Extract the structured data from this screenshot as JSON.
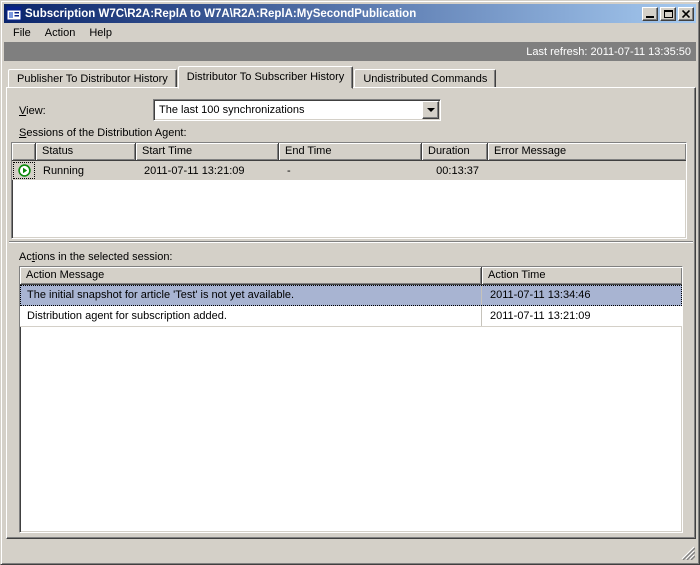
{
  "window": {
    "title": "Subscription W7C\\R2A:ReplA to W7A\\R2A:ReplA:MySecondPublication",
    "icons": {
      "app": "window-grid-icon",
      "minimize": "minimize-underscore",
      "maximize": "maximize-square",
      "close": "close-x",
      "resize_grip": "diagonal-lines"
    }
  },
  "menu": {
    "items": [
      {
        "label": "File"
      },
      {
        "label": "Action"
      },
      {
        "label": "Help"
      }
    ]
  },
  "refresh_bar": {
    "last_refresh": "Last refresh: 2011-07-11 13:35:50"
  },
  "tabs": [
    {
      "label": "Publisher To Distributor History",
      "active": false
    },
    {
      "label": "Distributor To Subscriber History",
      "active": true
    },
    {
      "label": "Undistributed Commands",
      "active": false
    }
  ],
  "view": {
    "label_mnemonic": "V",
    "label_rest": "iew:",
    "value": "The last 100 synchronizations",
    "dropdown_icon": "chevron-down-triangle"
  },
  "sessions": {
    "label_mnemonic": "S",
    "label_rest": "essions of the Distribution Agent:",
    "columns": {
      "icon": "",
      "status": "Status",
      "start": "Start Time",
      "end": "End Time",
      "duration": "Duration",
      "error": "Error Message"
    },
    "rows": [
      {
        "status_icon": "running-play-circle",
        "status": "Running",
        "start": "2011-07-11 13:21:09",
        "end": "-",
        "duration": "00:13:37",
        "error": "",
        "selected": true
      }
    ]
  },
  "actions": {
    "label_pre": "Ac",
    "label_mnemonic": "t",
    "label_rest": "ions in the selected session:",
    "columns": {
      "message": "Action Message",
      "time": "Action Time"
    },
    "rows": [
      {
        "message": "The initial snapshot for article 'Test' is not yet available.",
        "time": "2011-07-11 13:34:46",
        "selected": true
      },
      {
        "message": "Distribution agent for subscription added.",
        "time": "2011-07-11 13:21:09",
        "selected": false
      }
    ]
  },
  "colors": {
    "titlebar_left": "#0a246a",
    "titlebar_right": "#a6caf0",
    "chrome": "#d4d0c8",
    "refresh_bar_bg": "#7f7f7f",
    "selected_action_row": "#a8b4d2",
    "selected_session_row": "#d4d0c8",
    "running_green": "#0c8a0c"
  }
}
